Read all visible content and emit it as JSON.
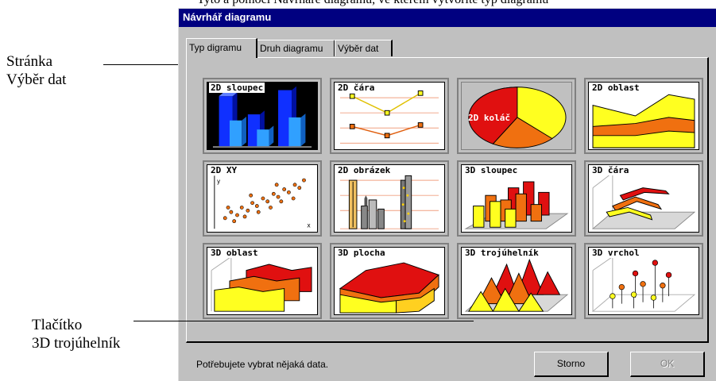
{
  "top_text_cut": "Tyto a pomocí Návrháře diagramu, ve kterém vytvoříte typ diagramu",
  "callouts": {
    "page_label_line1": "Stránka",
    "page_label_line2": "Výběr dat",
    "button_label_line1": "Tlačítko",
    "button_label_line2": "3D trojúhelník"
  },
  "dialog": {
    "title": "Návrhář diagramu",
    "tabs": [
      "Typ digramu",
      "Druh diagramu",
      "Výběr dat"
    ],
    "status": "Potřebujete vybrat nějaká data.",
    "cancel_label": "Storno",
    "ok_label": "OK"
  },
  "chart_types": [
    {
      "label": "2D sloupec",
      "icon": "2d-column-icon",
      "selected": true
    },
    {
      "label": "2D čára",
      "icon": "2d-line-icon",
      "selected": false
    },
    {
      "label": "2D koláč",
      "icon": "2d-pie-icon",
      "selected": false
    },
    {
      "label": "2D oblast",
      "icon": "2d-area-icon",
      "selected": false
    },
    {
      "label": "2D XY",
      "icon": "2d-xy-icon",
      "selected": false
    },
    {
      "label": "2D obrázek",
      "icon": "2d-picture-icon",
      "selected": false
    },
    {
      "label": "3D sloupec",
      "icon": "3d-column-icon",
      "selected": false
    },
    {
      "label": "3D čára",
      "icon": "3d-line-icon",
      "selected": false
    },
    {
      "label": "3D oblast",
      "icon": "3d-area-icon",
      "selected": false
    },
    {
      "label": "3D plocha",
      "icon": "3d-surface-icon",
      "selected": false
    },
    {
      "label": "3D trojúhelník",
      "icon": "3d-triangle-icon",
      "selected": false
    },
    {
      "label": "3D vrchol",
      "icon": "3d-peak-icon",
      "selected": false
    }
  ],
  "colors": {
    "title_bar": "#000080",
    "face": "#c0c0c0",
    "red": "#e01010",
    "yellow": "#ffff20",
    "orange": "#f07010",
    "blue": "#1030ff"
  }
}
